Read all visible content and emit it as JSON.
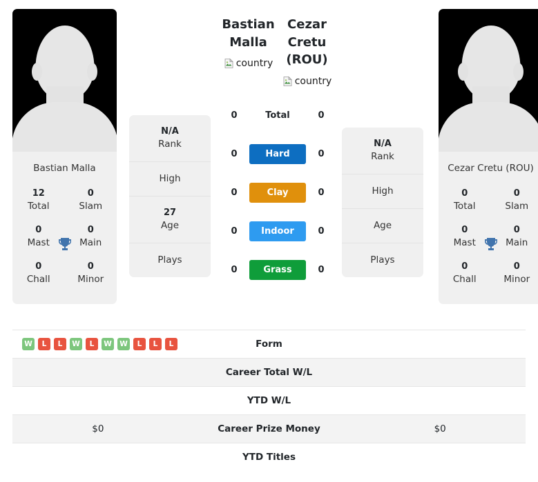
{
  "players": {
    "left": {
      "name": "Bastian Malla",
      "card_name": "Bastian Malla",
      "country_alt": "country",
      "titles": [
        {
          "value": "12",
          "label": "Total"
        },
        {
          "value": "0",
          "label": "Slam"
        },
        {
          "value": "0",
          "label": "Mast"
        },
        {
          "value": "0",
          "label": "Main"
        },
        {
          "value": "0",
          "label": "Chall"
        },
        {
          "value": "0",
          "label": "Minor"
        }
      ],
      "info": [
        {
          "value": "N/A",
          "label": "Rank"
        },
        {
          "value": "",
          "label": "High"
        },
        {
          "value": "27",
          "label": "Age"
        },
        {
          "value": "",
          "label": "Plays"
        }
      ],
      "surface_values": [
        "0",
        "0",
        "0",
        "0",
        "0"
      ],
      "form": [
        "W",
        "L",
        "L",
        "W",
        "L",
        "W",
        "W",
        "L",
        "L",
        "L"
      ],
      "career_total_wl": "",
      "ytd_wl": "",
      "career_prize_money": "$0",
      "ytd_titles": ""
    },
    "right": {
      "name": "Cezar Cretu (ROU)",
      "card_name": "Cezar Cretu (ROU)",
      "country_alt": "country",
      "titles": [
        {
          "value": "0",
          "label": "Total"
        },
        {
          "value": "0",
          "label": "Slam"
        },
        {
          "value": "0",
          "label": "Mast"
        },
        {
          "value": "0",
          "label": "Main"
        },
        {
          "value": "0",
          "label": "Chall"
        },
        {
          "value": "0",
          "label": "Minor"
        }
      ],
      "info": [
        {
          "value": "N/A",
          "label": "Rank"
        },
        {
          "value": "",
          "label": "High"
        },
        {
          "value": "",
          "label": "Age"
        },
        {
          "value": "",
          "label": "Plays"
        }
      ],
      "surface_values": [
        "0",
        "0",
        "0",
        "0",
        "0"
      ],
      "form": [],
      "career_total_wl": "",
      "ytd_wl": "",
      "career_prize_money": "$0",
      "ytd_titles": ""
    }
  },
  "surfaces": [
    {
      "label": "Total",
      "color": "transparent",
      "plain": true
    },
    {
      "label": "Hard",
      "color": "#0d6ec1",
      "plain": false
    },
    {
      "label": "Clay",
      "color": "#e0900c",
      "plain": false
    },
    {
      "label": "Indoor",
      "color": "#2e9bf0",
      "plain": false
    },
    {
      "label": "Grass",
      "color": "#0f9d3a",
      "plain": false
    }
  ],
  "stats_rows": [
    {
      "label": "Form"
    },
    {
      "label": "Career Total W/L"
    },
    {
      "label": "YTD W/L"
    },
    {
      "label": "Career Prize Money"
    },
    {
      "label": "YTD Titles"
    }
  ],
  "colors": {
    "win": "#7dc67d",
    "loss": "#e8533f",
    "trophy": "#4174ad",
    "card_bg": "#f0f0f0",
    "row_alt": "#f3f3f3"
  },
  "icons": {
    "trophy": "trophy-icon",
    "broken_image": "broken-image-icon"
  }
}
